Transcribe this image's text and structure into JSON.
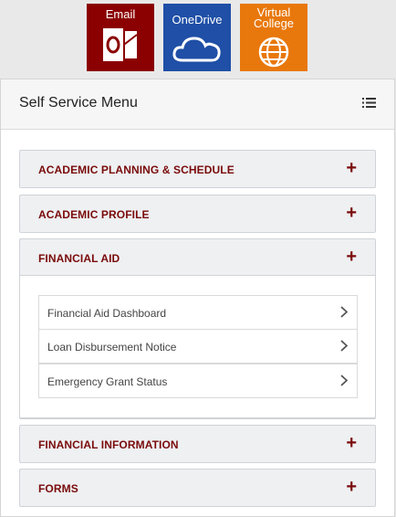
{
  "top_links": {
    "email": "Email",
    "onedrive": "OneDrive",
    "virtual_college_line1": "Virtual",
    "virtual_college_line2": "College"
  },
  "panel": {
    "title": "Self Service Menu"
  },
  "sections": [
    {
      "label": "ACADEMIC PLANNING & SCHEDULE",
      "expanded": false
    },
    {
      "label": "ACADEMIC PROFILE",
      "expanded": false
    },
    {
      "label": "FINANCIAL AID",
      "expanded": true,
      "items": [
        "Financial Aid Dashboard",
        "Loan Disbursement Notice",
        "Emergency Grant Status"
      ]
    },
    {
      "label": "FINANCIAL INFORMATION",
      "expanded": false
    },
    {
      "label": "FORMS",
      "expanded": false
    }
  ],
  "colors": {
    "email_tile": "#8b0000",
    "onedrive_tile": "#1f4fa6",
    "virtual_college_tile": "#e8780c",
    "accent": "#7a0a0a"
  },
  "icons": {
    "panel_toggle": "list-icon",
    "expand": "plus-icon",
    "item": "chevron-right-icon"
  }
}
